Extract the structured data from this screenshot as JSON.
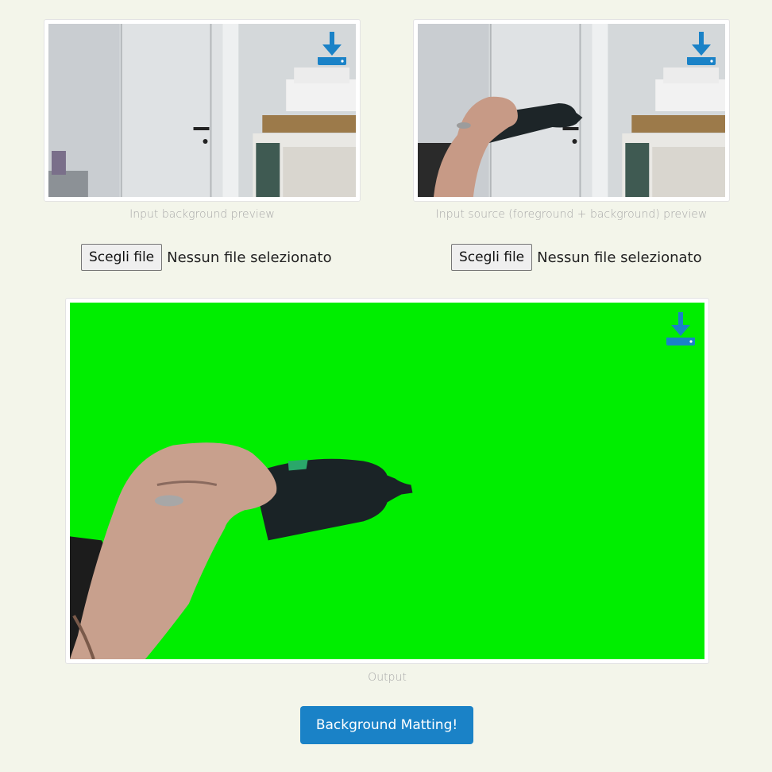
{
  "panels": {
    "background": {
      "caption": "Input background preview",
      "download_icon": "download-tray-icon"
    },
    "source": {
      "caption": "Input source (foreground + background) preview",
      "download_icon": "download-tray-icon"
    },
    "output": {
      "caption": "Output",
      "download_icon": "download-tray-icon"
    }
  },
  "file_inputs": [
    {
      "button_label": "Scegli file",
      "status": "Nessun file selezionato"
    },
    {
      "button_label": "Scegli file",
      "status": "Nessun file selezionato"
    }
  ],
  "action_button": {
    "label": "Background Matting!"
  },
  "colors": {
    "accent": "#1a82c7",
    "page_bg": "#f3f5ea",
    "chroma_green": "#00ee00",
    "caption": "#a9a9a9"
  }
}
